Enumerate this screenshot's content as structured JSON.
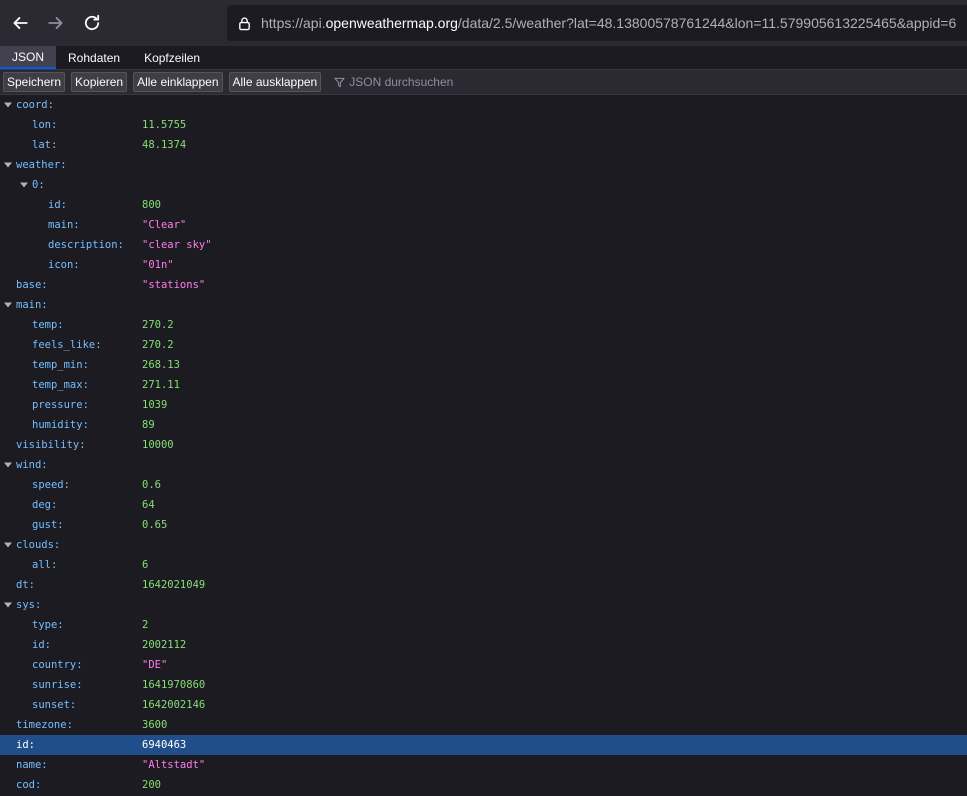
{
  "browser": {
    "url_prefix": "https://api.",
    "url_host": "openweathermap.org",
    "url_rest": "/data/2.5/weather?lat=48.13800578761244&lon=11.579905613225465&appid=6"
  },
  "tabs": [
    "JSON",
    "Rohdaten",
    "Kopfzeilen"
  ],
  "toolbar": {
    "save": "Speichern",
    "copy": "Kopieren",
    "collapse_all": "Alle einklappen",
    "expand_all": "Alle ausklappen",
    "filter_placeholder": "JSON durchsuchen"
  },
  "rows": [
    {
      "key": "coord:",
      "depth": 0,
      "toggle": true
    },
    {
      "key": "lon:",
      "depth": 1,
      "value": "11.5755",
      "type": "num"
    },
    {
      "key": "lat:",
      "depth": 1,
      "value": "48.1374",
      "type": "num"
    },
    {
      "key": "weather:",
      "depth": 0,
      "toggle": true
    },
    {
      "key": "0:",
      "depth": 1,
      "toggle": true
    },
    {
      "key": "id:",
      "depth": 2,
      "value": "800",
      "type": "num"
    },
    {
      "key": "main:",
      "depth": 2,
      "value": "\"Clear\"",
      "type": "str"
    },
    {
      "key": "description:",
      "depth": 2,
      "value": "\"clear sky\"",
      "type": "str"
    },
    {
      "key": "icon:",
      "depth": 2,
      "value": "\"01n\"",
      "type": "str"
    },
    {
      "key": "base:",
      "depth": 0,
      "value": "\"stations\"",
      "type": "str"
    },
    {
      "key": "main:",
      "depth": 0,
      "toggle": true
    },
    {
      "key": "temp:",
      "depth": 1,
      "value": "270.2",
      "type": "num"
    },
    {
      "key": "feels_like:",
      "depth": 1,
      "value": "270.2",
      "type": "num"
    },
    {
      "key": "temp_min:",
      "depth": 1,
      "value": "268.13",
      "type": "num"
    },
    {
      "key": "temp_max:",
      "depth": 1,
      "value": "271.11",
      "type": "num"
    },
    {
      "key": "pressure:",
      "depth": 1,
      "value": "1039",
      "type": "num"
    },
    {
      "key": "humidity:",
      "depth": 1,
      "value": "89",
      "type": "num"
    },
    {
      "key": "visibility:",
      "depth": 0,
      "value": "10000",
      "type": "num"
    },
    {
      "key": "wind:",
      "depth": 0,
      "toggle": true
    },
    {
      "key": "speed:",
      "depth": 1,
      "value": "0.6",
      "type": "num"
    },
    {
      "key": "deg:",
      "depth": 1,
      "value": "64",
      "type": "num"
    },
    {
      "key": "gust:",
      "depth": 1,
      "value": "0.65",
      "type": "num"
    },
    {
      "key": "clouds:",
      "depth": 0,
      "toggle": true
    },
    {
      "key": "all:",
      "depth": 1,
      "value": "6",
      "type": "num"
    },
    {
      "key": "dt:",
      "depth": 0,
      "value": "1642021049",
      "type": "num"
    },
    {
      "key": "sys:",
      "depth": 0,
      "toggle": true
    },
    {
      "key": "type:",
      "depth": 1,
      "value": "2",
      "type": "num"
    },
    {
      "key": "id:",
      "depth": 1,
      "value": "2002112",
      "type": "num"
    },
    {
      "key": "country:",
      "depth": 1,
      "value": "\"DE\"",
      "type": "str"
    },
    {
      "key": "sunrise:",
      "depth": 1,
      "value": "1641970860",
      "type": "num"
    },
    {
      "key": "sunset:",
      "depth": 1,
      "value": "1642002146",
      "type": "num"
    },
    {
      "key": "timezone:",
      "depth": 0,
      "value": "3600",
      "type": "num"
    },
    {
      "key": "id:",
      "depth": 0,
      "value": "6940463",
      "type": "num",
      "selected": true
    },
    {
      "key": "name:",
      "depth": 0,
      "value": "\"Altstadt\"",
      "type": "str"
    },
    {
      "key": "cod:",
      "depth": 0,
      "value": "200",
      "type": "num"
    }
  ]
}
